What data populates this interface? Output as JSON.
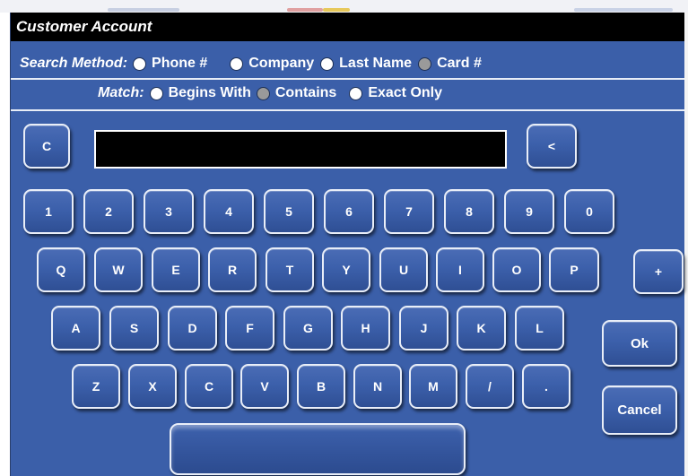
{
  "window": {
    "title": "Customer Account"
  },
  "search_method": {
    "label": "Search Method:",
    "options": [
      {
        "label": "Phone #",
        "selected": false
      },
      {
        "label": "Company",
        "selected": false
      },
      {
        "label": "Last Name",
        "selected": false
      },
      {
        "label": "Card #",
        "selected": true
      }
    ]
  },
  "match": {
    "label": "Match:",
    "options": [
      {
        "label": "Begins With",
        "selected": false
      },
      {
        "label": "Contains",
        "selected": true
      },
      {
        "label": "Exact Only",
        "selected": false
      }
    ]
  },
  "entry": {
    "value": ""
  },
  "keys": {
    "clear": "C",
    "backspace": "<",
    "plus": "+",
    "ok": "Ok",
    "cancel": "Cancel",
    "row1": [
      "1",
      "2",
      "3",
      "4",
      "5",
      "6",
      "7",
      "8",
      "9",
      "0"
    ],
    "row2": [
      "Q",
      "W",
      "E",
      "R",
      "T",
      "Y",
      "U",
      "I",
      "O",
      "P"
    ],
    "row3": [
      "A",
      "S",
      "D",
      "F",
      "G",
      "H",
      "J",
      "K",
      "L"
    ],
    "row4": [
      "Z",
      "X",
      "C",
      "V",
      "B",
      "N",
      "M",
      "/",
      "."
    ]
  },
  "colors": {
    "background": "#3b5fa9",
    "titlebar": "#000000",
    "key_border": "#e9eef8",
    "radio_selected": "#9a9a9a"
  }
}
